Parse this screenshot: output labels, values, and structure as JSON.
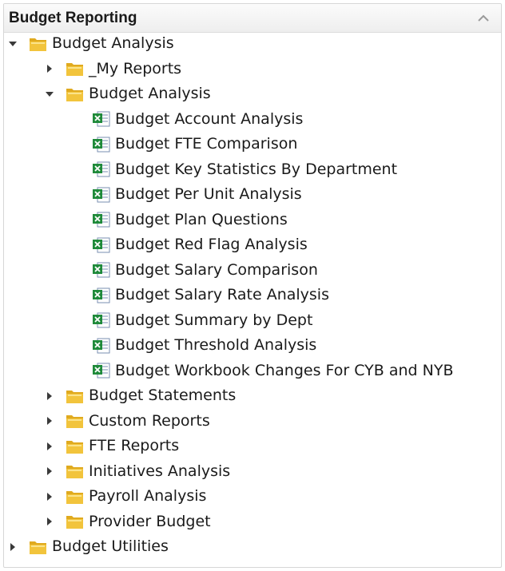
{
  "panel": {
    "title": "Budget Reporting",
    "collapse_icon": "chevron-up-icon"
  },
  "tree": [
    {
      "label": "Budget Analysis",
      "type": "folder",
      "level": 0,
      "state": "expanded"
    },
    {
      "label": "_My Reports",
      "type": "folder",
      "level": 1,
      "state": "collapsed"
    },
    {
      "label": "Budget Analysis",
      "type": "folder",
      "level": 1,
      "state": "expanded"
    },
    {
      "label": "Budget Account Analysis",
      "type": "report",
      "level": 2
    },
    {
      "label": "Budget FTE Comparison",
      "type": "report",
      "level": 2
    },
    {
      "label": "Budget Key Statistics By Department",
      "type": "report",
      "level": 2
    },
    {
      "label": "Budget Per Unit Analysis",
      "type": "report",
      "level": 2
    },
    {
      "label": "Budget Plan Questions",
      "type": "report",
      "level": 2
    },
    {
      "label": "Budget Red Flag Analysis",
      "type": "report",
      "level": 2
    },
    {
      "label": "Budget Salary Comparison",
      "type": "report",
      "level": 2
    },
    {
      "label": "Budget Salary Rate Analysis",
      "type": "report",
      "level": 2
    },
    {
      "label": "Budget Summary by Dept",
      "type": "report",
      "level": 2
    },
    {
      "label": "Budget Threshold Analysis",
      "type": "report",
      "level": 2
    },
    {
      "label": "Budget Workbook Changes For CYB and NYB",
      "type": "report",
      "level": 2
    },
    {
      "label": "Budget Statements",
      "type": "folder",
      "level": 1,
      "state": "collapsed"
    },
    {
      "label": "Custom Reports",
      "type": "folder",
      "level": 1,
      "state": "collapsed"
    },
    {
      "label": "FTE Reports",
      "type": "folder",
      "level": 1,
      "state": "collapsed"
    },
    {
      "label": "Initiatives Analysis",
      "type": "folder",
      "level": 1,
      "state": "collapsed"
    },
    {
      "label": "Payroll Analysis",
      "type": "folder",
      "level": 1,
      "state": "collapsed"
    },
    {
      "label": "Provider Budget",
      "type": "folder",
      "level": 1,
      "state": "collapsed"
    },
    {
      "label": "Budget Utilities",
      "type": "folder",
      "level": 0,
      "state": "collapsed"
    }
  ],
  "icons": {
    "folder": "folder-icon",
    "report": "excel-file-icon",
    "expanded": "triangle-down-icon",
    "collapsed": "triangle-right-icon"
  },
  "colors": {
    "header_bg": "#eeeeee",
    "folder": "#f2c43c",
    "excel_green": "#1f8a3a"
  }
}
